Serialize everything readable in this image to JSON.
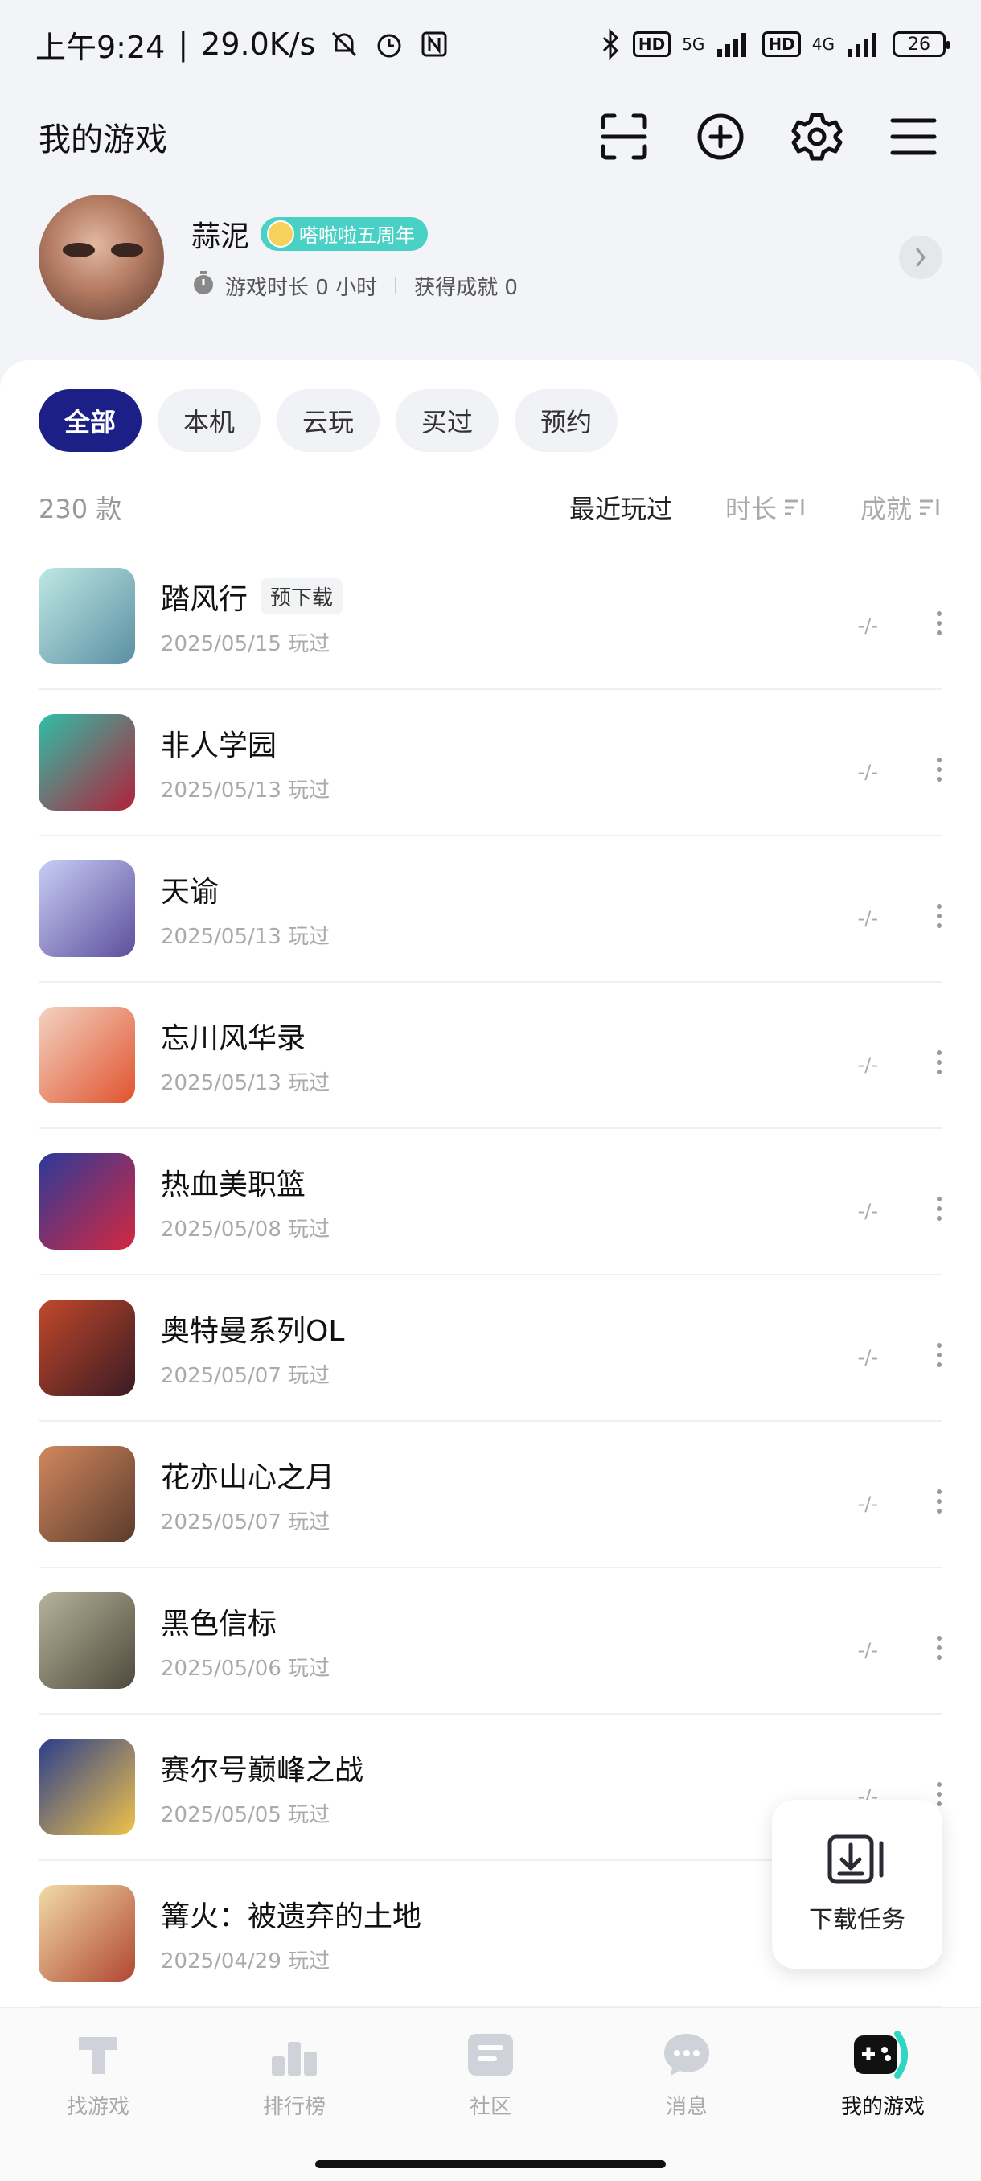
{
  "status_bar": {
    "time": "上午9:24",
    "speed": "29.0K/s",
    "network1": "5G",
    "network2": "4G",
    "hd": "HD",
    "battery": "26"
  },
  "header": {
    "title": "我的游戏",
    "icons": [
      "scan-icon",
      "add-circle-icon",
      "settings-gear-icon",
      "menu-icon"
    ]
  },
  "profile": {
    "name": "蒜泥",
    "badge": "嗒啦啦五周年",
    "play_time": "游戏时长 0 小时",
    "achievements": "获得成就 0"
  },
  "filters": [
    {
      "label": "全部",
      "active": true
    },
    {
      "label": "本机",
      "active": false
    },
    {
      "label": "云玩",
      "active": false
    },
    {
      "label": "买过",
      "active": false
    },
    {
      "label": "预约",
      "active": false
    }
  ],
  "sort": {
    "count": "230 款",
    "recent": "最近玩过",
    "duration": "时长",
    "achievement": "成就"
  },
  "games": [
    {
      "title": "踏风行",
      "tag": "预下载",
      "date": "2025/05/15 玩过",
      "stat": "-/-",
      "color1": "#bfe8e4",
      "color2": "#5a8fa3"
    },
    {
      "title": "非人学园",
      "tag": "",
      "date": "2025/05/13 玩过",
      "stat": "-/-",
      "color1": "#2fbfa8",
      "color2": "#b2203a"
    },
    {
      "title": "天谕",
      "tag": "",
      "date": "2025/05/13 玩过",
      "stat": "-/-",
      "color1": "#c8cef5",
      "color2": "#5d4f9c"
    },
    {
      "title": "忘川风华录",
      "tag": "",
      "date": "2025/05/13 玩过",
      "stat": "-/-",
      "color1": "#f3d3c2",
      "color2": "#e0532e"
    },
    {
      "title": "热血美职篮",
      "tag": "",
      "date": "2025/05/08 玩过",
      "stat": "-/-",
      "color1": "#2b3a9a",
      "color2": "#d4283f"
    },
    {
      "title": "奥特曼系列OL",
      "tag": "",
      "date": "2025/05/07 玩过",
      "stat": "-/-",
      "color1": "#c2482a",
      "color2": "#3a1b24"
    },
    {
      "title": "花亦山心之月",
      "tag": "",
      "date": "2025/05/07 玩过",
      "stat": "-/-",
      "color1": "#d2885e",
      "color2": "#5a3b2c"
    },
    {
      "title": "黑色信标",
      "tag": "",
      "date": "2025/05/06 玩过",
      "stat": "-/-",
      "color1": "#b6b39a",
      "color2": "#4e4a3c"
    },
    {
      "title": "赛尔号巅峰之战",
      "tag": "",
      "date": "2025/05/05 玩过",
      "stat": "-/-",
      "color1": "#2a3d8c",
      "color2": "#f0c24a"
    },
    {
      "title": "篝火：被遗弃的土地",
      "tag": "",
      "date": "2025/04/29 玩过",
      "stat": "",
      "color1": "#f1dca6",
      "color2": "#b04632"
    }
  ],
  "fab": {
    "label": "下载任务"
  },
  "bottom_nav": [
    {
      "label": "找游戏",
      "icon": "find-game-icon",
      "active": false
    },
    {
      "label": "排行榜",
      "icon": "leaderboard-icon",
      "active": false
    },
    {
      "label": "社区",
      "icon": "community-icon",
      "active": false
    },
    {
      "label": "消息",
      "icon": "message-icon",
      "active": false
    },
    {
      "label": "我的游戏",
      "icon": "my-games-icon",
      "active": true
    }
  ],
  "colors": {
    "accent": "#1b1f86",
    "badge": "#49d1c5",
    "nav_active": "#111111",
    "nav_inactive": "#aaaaaa"
  }
}
